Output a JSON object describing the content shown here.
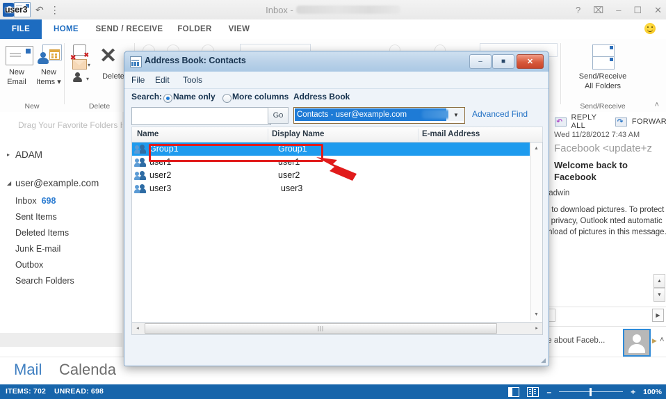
{
  "app": {
    "user_badge": "user3",
    "title_prefix": "Inbox - ",
    "window_controls": {
      "help": "?",
      "ribbon_options": "⌧",
      "minimize": "–",
      "maximize": "☐",
      "close": "✕"
    }
  },
  "ribbon": {
    "tabs": [
      {
        "id": "file",
        "label": "FILE"
      },
      {
        "id": "home",
        "label": "HOME"
      },
      {
        "id": "send_receive",
        "label": "SEND / RECEIVE"
      },
      {
        "id": "folder",
        "label": "FOLDER"
      },
      {
        "id": "view",
        "label": "VIEW"
      }
    ],
    "groups": [
      {
        "name": "New",
        "buttons": [
          {
            "label": "New\nEmail",
            "line1": "New",
            "line2": "Email"
          },
          {
            "label": "New Items",
            "line1": "New",
            "line2": "Items ▾"
          }
        ]
      },
      {
        "name": "Delete",
        "buttons": [
          {
            "line1": "Delete"
          }
        ]
      },
      {
        "name": "Send/Receive",
        "buttons": [
          {
            "line1": "Send/Receive",
            "line2": "All Folders"
          }
        ]
      }
    ],
    "collapse_icon": "˄"
  },
  "favorites": {
    "hint": "Drag Your Favorite Folders Here"
  },
  "folder_pane": {
    "accounts": [
      {
        "name": "ADAM",
        "expanded": false,
        "arrow": "▸"
      },
      {
        "name": "user@example.com",
        "expanded": true,
        "arrow": "◢"
      }
    ],
    "folders": [
      {
        "label": "Inbox",
        "count": "698",
        "selected": true
      },
      {
        "label": "Sent Items",
        "count": "",
        "selected": false
      },
      {
        "label": "Deleted Items",
        "count": "",
        "selected": false
      },
      {
        "label": "Junk E-mail",
        "count": "",
        "selected": false
      },
      {
        "label": "Outbox",
        "count": "",
        "selected": false
      },
      {
        "label": "Search Folders",
        "count": "",
        "selected": false
      }
    ]
  },
  "reading_pane": {
    "reply_all": "REPLY ALL",
    "forward": "FORWAR",
    "date": "Wed 11/28/2012 7:43 AM",
    "from": "Facebook <update+z",
    "subject": "Welcome back to Facebook",
    "to": "Bladwin",
    "info_bar": "here to download pictures. To protect your privacy, Outlook nted automatic download of pictures in this message.",
    "people_pane_text": "ore about Faceb...",
    "scroll_up": "▲",
    "scroll_down": "▼",
    "play": "▶",
    "expand": "˄"
  },
  "module_bar": {
    "mail": "Mail",
    "calendar": "Calenda"
  },
  "status_bar": {
    "items": "ITEMS: 702",
    "unread": "UNREAD: 698",
    "zoom_percent": "100%",
    "zoom_minus": "–",
    "zoom_plus": "+"
  },
  "dialog": {
    "title": "Address Book: Contacts",
    "window_buttons": {
      "minimize": "–",
      "maximize": "■",
      "close": "✕"
    },
    "menus": [
      "File",
      "Edit",
      "Tools"
    ],
    "search": {
      "label": "Search:",
      "options": [
        {
          "label": "Name only",
          "selected": true
        },
        {
          "label": "More columns",
          "selected": false
        }
      ],
      "input_value": "",
      "input_placeholder": "",
      "go_label": "Go"
    },
    "address_book": {
      "label": "Address Book",
      "selected_value": "Contacts - user@example.com",
      "dropdown_arrow": "▼",
      "advanced_find": "Advanced Find"
    },
    "columns": [
      "Name",
      "Display Name",
      "E-mail Address"
    ],
    "rows": [
      {
        "name": "Group1",
        "display_name": "Group1",
        "email": "",
        "selected": true
      },
      {
        "name": "user1",
        "display_name": "user1",
        "email": "",
        "selected": false
      },
      {
        "name": "user2",
        "display_name": "user2",
        "email": "",
        "selected": false
      },
      {
        "name": "user3",
        "display_name": "user3",
        "email": "",
        "selected": false
      }
    ],
    "scroll": {
      "up": "▲",
      "down": "▼",
      "left": "◂",
      "right": "▸",
      "thumb_grip": "|||"
    }
  },
  "annotations": {
    "highlight_color": "#e11b1b",
    "target": "Group1 row"
  }
}
